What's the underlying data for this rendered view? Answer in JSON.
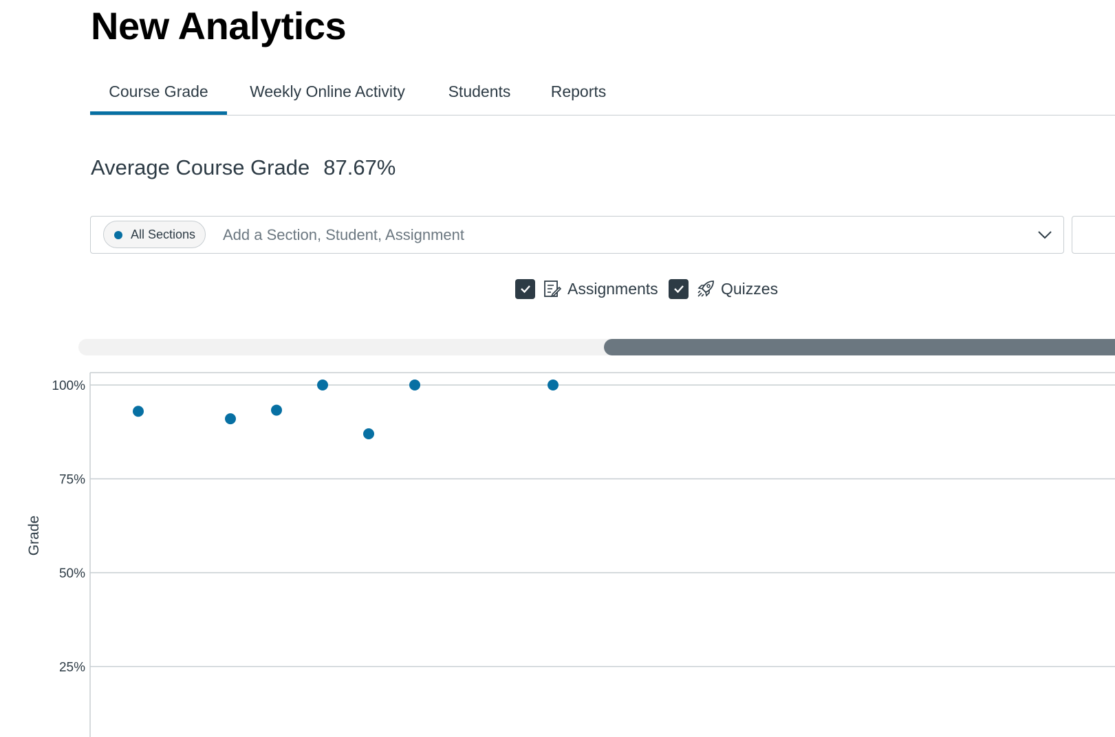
{
  "page": {
    "title": "New Analytics"
  },
  "tabs": [
    {
      "label": "Course Grade",
      "active": true
    },
    {
      "label": "Weekly Online Activity",
      "active": false
    },
    {
      "label": "Students",
      "active": false
    },
    {
      "label": "Reports",
      "active": false
    }
  ],
  "summary": {
    "label": "Average Course Grade",
    "value": "87.67%"
  },
  "filter": {
    "pill_label": "All Sections",
    "placeholder": "Add a Section, Student, Assignment",
    "chevron_icon": "chevron-down-icon",
    "accent_color": "#0770a3"
  },
  "legend": {
    "assignments": {
      "label": "Assignments",
      "checked": true,
      "icon": "assignment-icon"
    },
    "quizzes": {
      "label": "Quizzes",
      "checked": true,
      "icon": "rocket-icon"
    }
  },
  "scrollbar": {
    "position_fraction": 0.5
  },
  "chart_data": {
    "type": "scatter",
    "ylabel": "Grade",
    "yticks": [
      "100%",
      "75%",
      "50%",
      "25%"
    ],
    "ylim": [
      0,
      100
    ],
    "grid": true,
    "series": [
      {
        "color": "#0770a3",
        "points": [
          {
            "x": 1,
            "y": 93
          },
          {
            "x": 3,
            "y": 91
          },
          {
            "x": 4,
            "y": 93.3
          },
          {
            "x": 5,
            "y": 100
          },
          {
            "x": 6,
            "y": 87
          },
          {
            "x": 7,
            "y": 100
          },
          {
            "x": 10,
            "y": 100
          }
        ]
      }
    ]
  }
}
